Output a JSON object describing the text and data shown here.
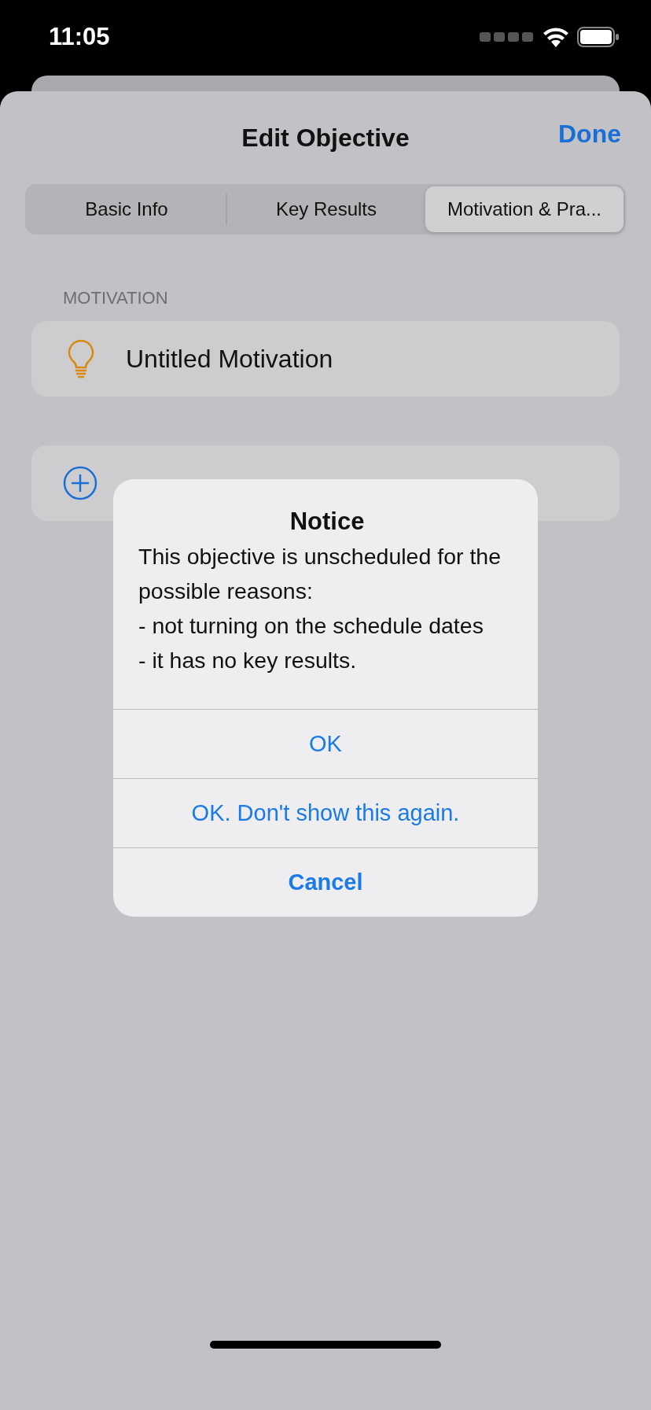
{
  "status_bar": {
    "time": "11:05"
  },
  "nav": {
    "title": "Edit Objective",
    "done": "Done"
  },
  "segments": [
    {
      "label": "Basic Info",
      "selected": false
    },
    {
      "label": "Key Results",
      "selected": false
    },
    {
      "label": "Motivation & Pra...",
      "selected": true
    }
  ],
  "section": {
    "header": "MOTIVATION",
    "items": [
      {
        "title": "Untitled Motivation"
      }
    ]
  },
  "alert": {
    "title": "Notice",
    "message": "This objective is unscheduled for the possible reasons:\n- not turning on the schedule dates\n- it has no key results.",
    "actions": [
      {
        "label": "OK",
        "kind": "default"
      },
      {
        "label": "OK. Don't show this again.",
        "kind": "default"
      },
      {
        "label": "Cancel",
        "kind": "cancel"
      }
    ]
  }
}
